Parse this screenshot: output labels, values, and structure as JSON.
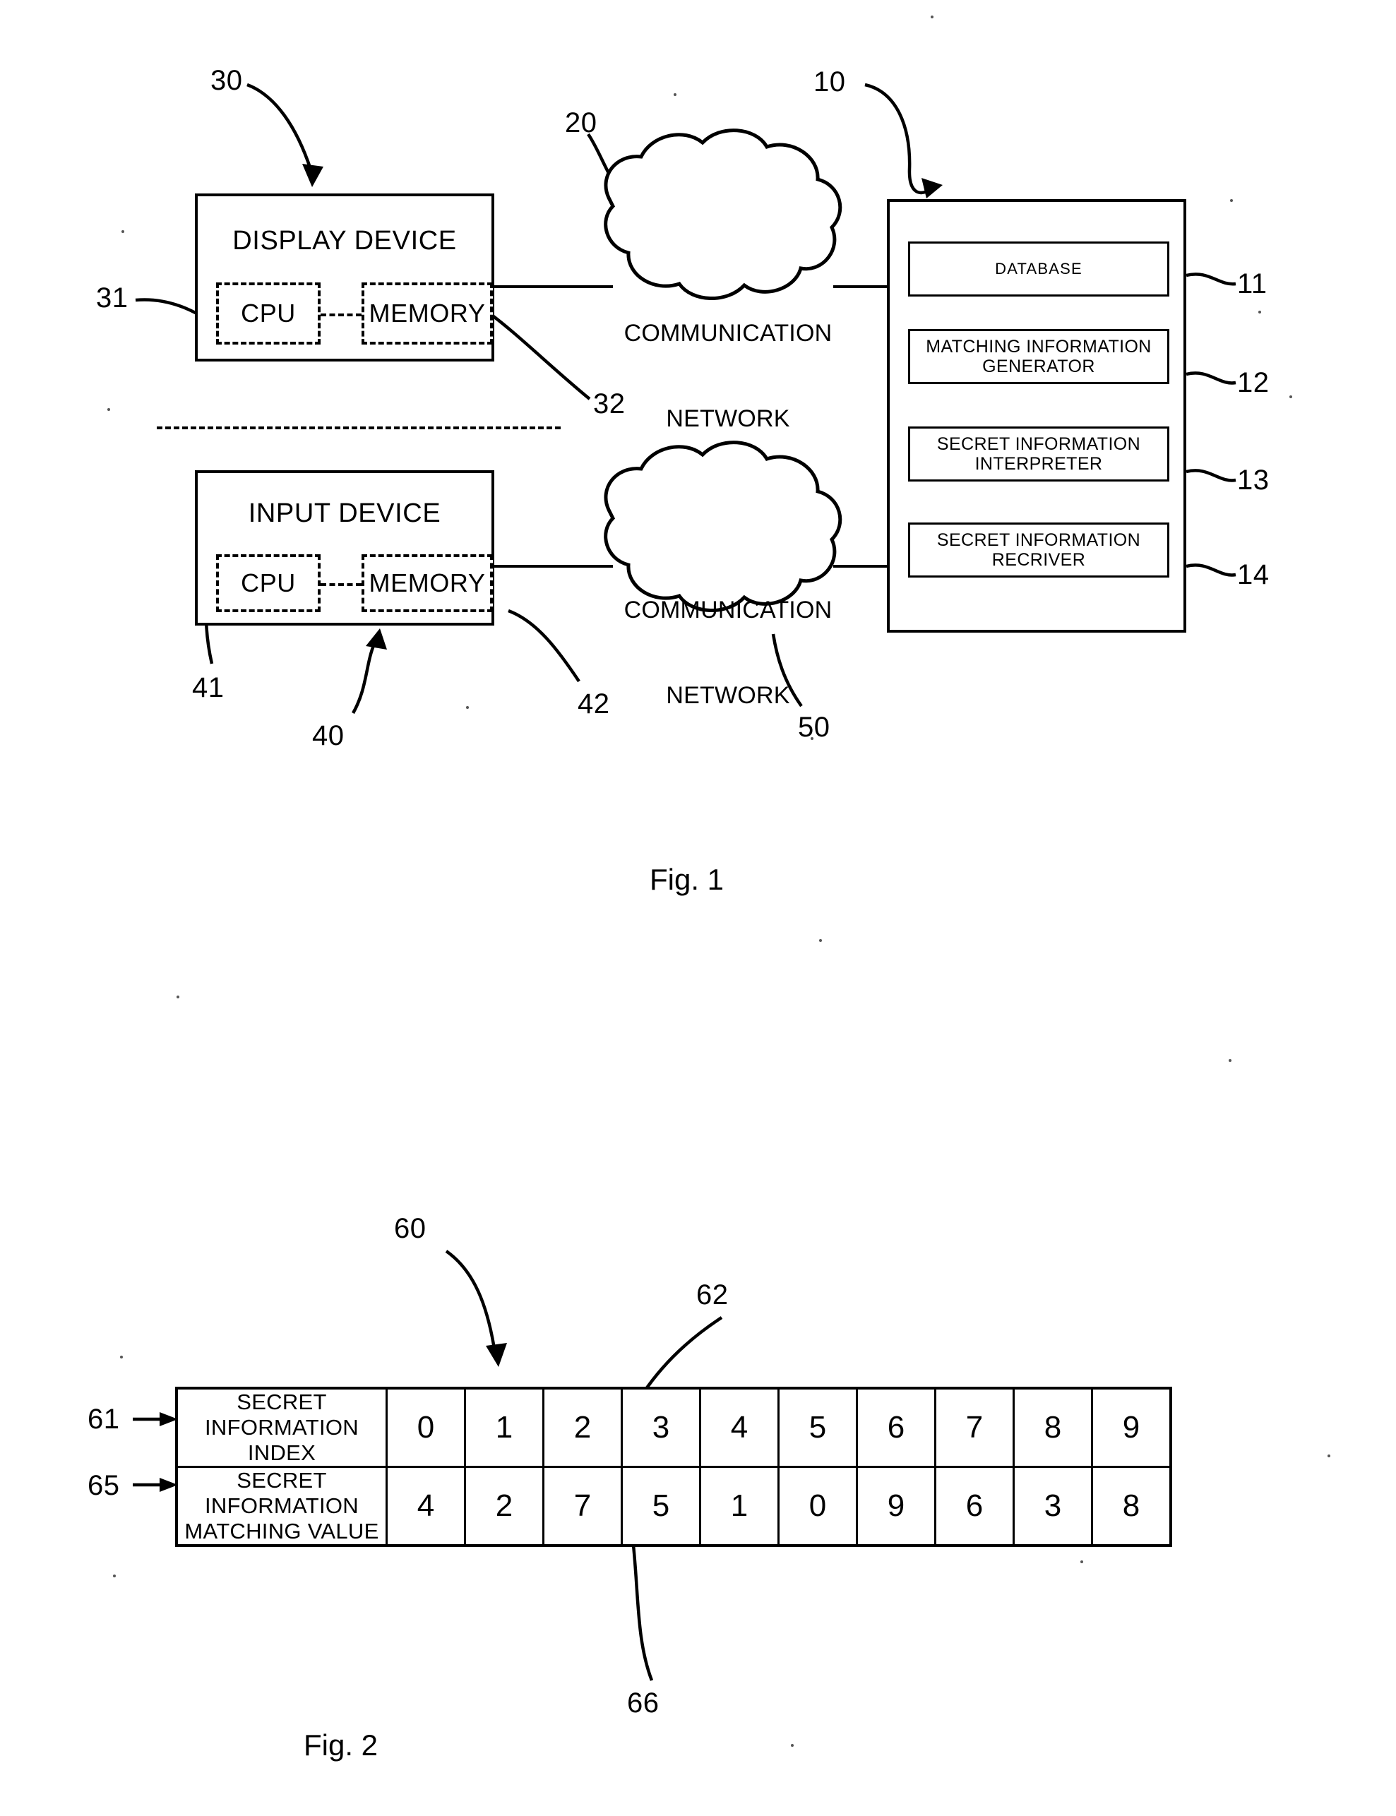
{
  "figure1": {
    "caption": "Fig. 1",
    "display_device": {
      "title": "DISPLAY DEVICE",
      "ref": "30",
      "cpu": {
        "label": "CPU",
        "ref": "31"
      },
      "memory": {
        "label": "MEMORY",
        "ref": "32"
      }
    },
    "input_device": {
      "title": "INPUT DEVICE",
      "ref": "40",
      "cpu": {
        "label": "CPU",
        "ref": "41"
      },
      "memory": {
        "label": "MEMORY",
        "ref": "42"
      }
    },
    "network_top": {
      "line1": "COMMUNICATION",
      "line2": "NETWORK",
      "ref": "20"
    },
    "network_bottom": {
      "line1": "COMMUNICATION",
      "line2": "NETWORK",
      "ref": "50"
    },
    "server": {
      "ref": "10",
      "components": [
        {
          "line1": "DATABASE",
          "line2": "",
          "ref": "11"
        },
        {
          "line1": "MATCHING INFORMATION",
          "line2": "GENERATOR",
          "ref": "12"
        },
        {
          "line1": "SECRET INFORMATION",
          "line2": "INTERPRETER",
          "ref": "13"
        },
        {
          "line1": "SECRET INFORMATION",
          "line2": "RECRIVER",
          "ref": "14"
        }
      ]
    }
  },
  "figure2": {
    "caption": "Fig. 2",
    "table_ref": "60",
    "cell_ref_index": "62",
    "cell_ref_value": "66",
    "rows": [
      {
        "ref": "61",
        "header_line1": "SECRET INFORMATION",
        "header_line2": "INDEX",
        "values": [
          "0",
          "1",
          "2",
          "3",
          "4",
          "5",
          "6",
          "7",
          "8",
          "9"
        ]
      },
      {
        "ref": "65",
        "header_line1": "SECRET INFORMATION",
        "header_line2": "MATCHING VALUE",
        "values": [
          "4",
          "2",
          "7",
          "5",
          "1",
          "0",
          "9",
          "6",
          "3",
          "8"
        ]
      }
    ]
  },
  "colors": {
    "ink": "#000000",
    "paper": "#ffffff"
  }
}
